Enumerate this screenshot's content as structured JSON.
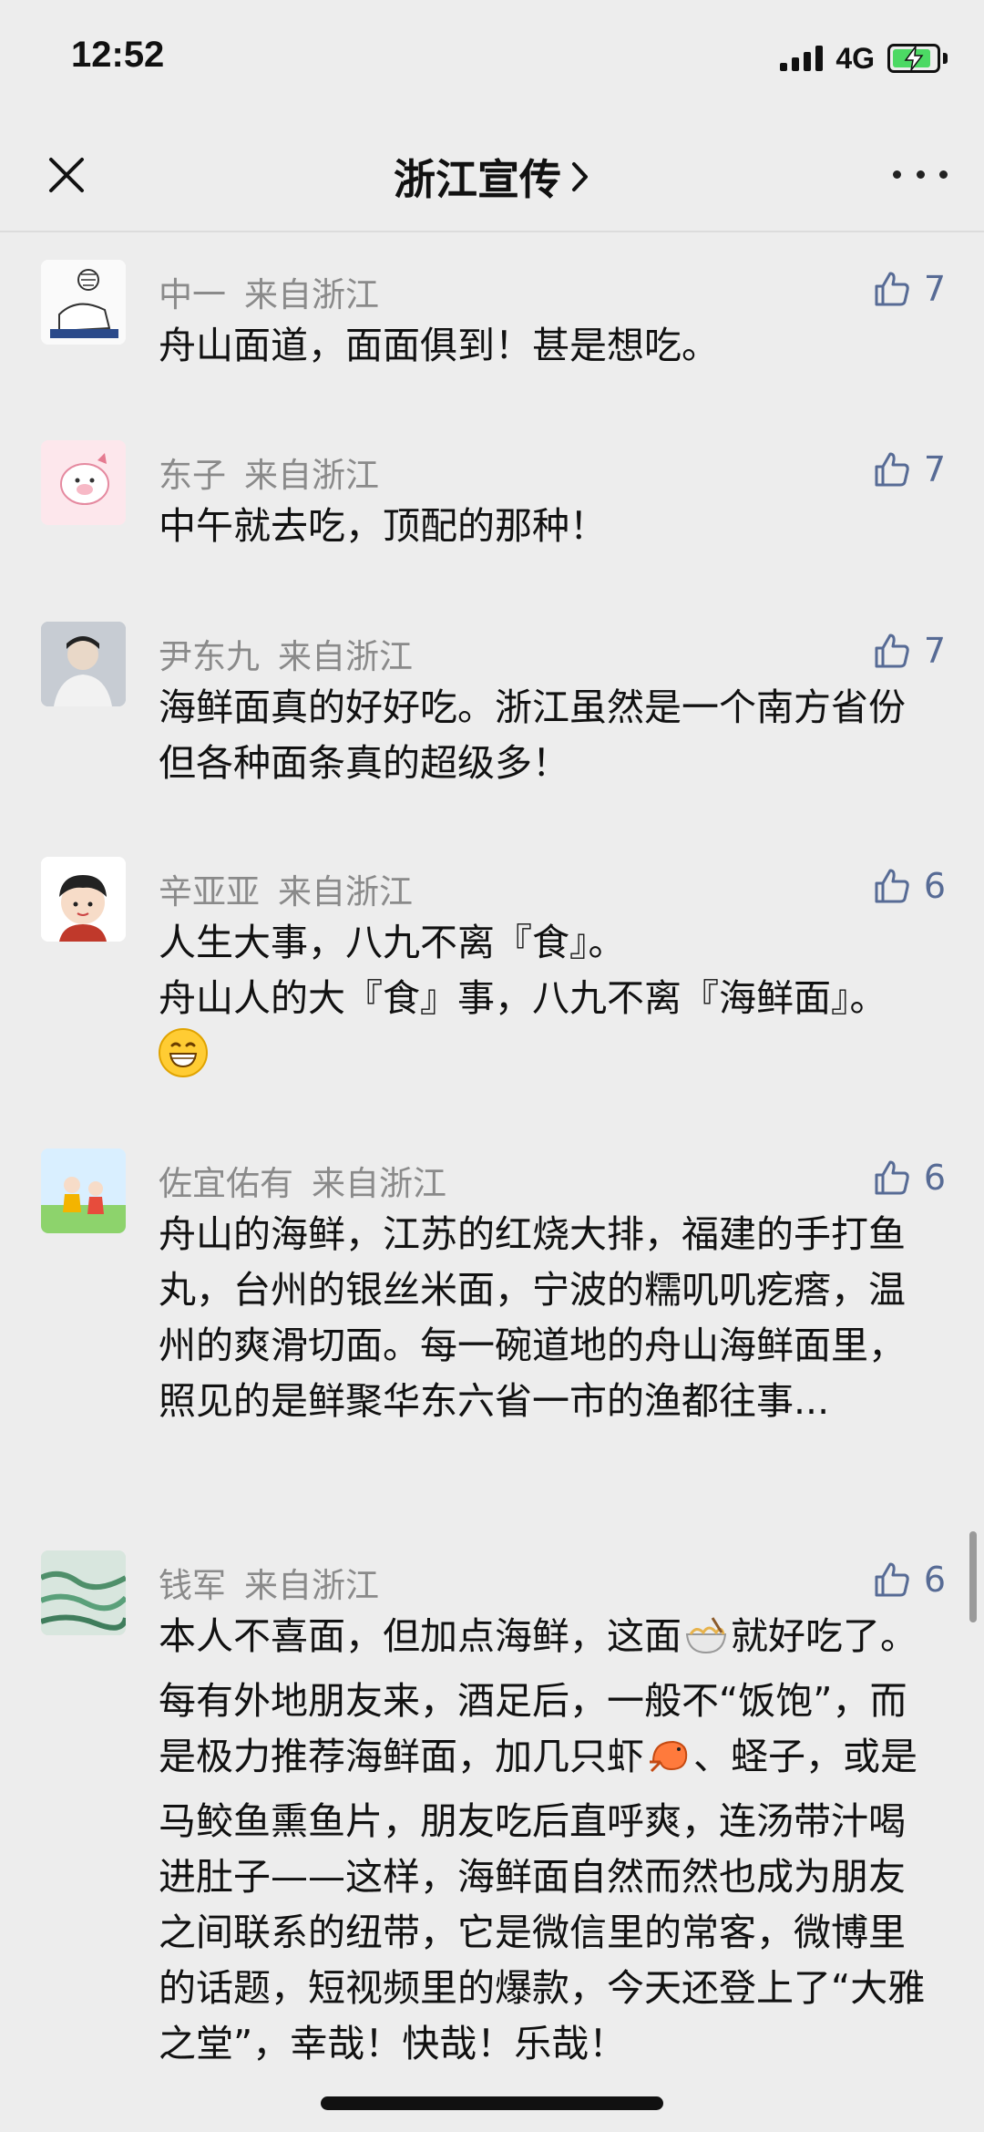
{
  "status_bar": {
    "time": "12:52",
    "network": "4G",
    "battery_icon": "battery-charging-icon",
    "signal_icon": "cellular-signal-icon"
  },
  "nav": {
    "title": "浙江宣传",
    "chevron": "›",
    "close_icon": "close-icon",
    "more_icon": "more-dots-icon"
  },
  "colors": {
    "background": "#ededed",
    "like_blue": "#576b95",
    "meta_gray": "#8a8a8a",
    "text": "#111111"
  },
  "comments": [
    {
      "name": "中一",
      "location": "来自浙江",
      "likes": "7",
      "text": "舟山面道，面面俱到！甚是想吃。"
    },
    {
      "name": "东子",
      "location": "来自浙江",
      "likes": "7",
      "text": "中午就去吃，顶配的那种！"
    },
    {
      "name": "尹东九",
      "location": "来自浙江",
      "likes": "7",
      "text": "海鲜面真的好好吃。浙江虽然是一个南方省份但各种面条真的超级多！"
    },
    {
      "name": "辛亚亚",
      "location": "来自浙江",
      "likes": "6",
      "text_line1": "人生大事，八九不离『食』。",
      "text_line2": "舟山人的大『食』事，八九不离『海鲜面』。",
      "emoji": "grinning-face-emoji"
    },
    {
      "name": "佐宜佑有",
      "location": "来自浙江",
      "likes": "6",
      "text": "舟山的海鲜，江苏的红烧大排，福建的手打鱼丸，台州的银丝米面，宁波的糯叽叽疙瘩，温州的爽滑切面。每一碗道地的舟山海鲜面里，照见的是鲜聚华东六省一市的渔都往事..."
    },
    {
      "name": "钱军",
      "location": "来自浙江",
      "likes": "6",
      "text_a": "本人不喜面，但加点海鲜，这面",
      "text_b": "就好吃了。每有外地朋友来，酒足后，一般不“饭饱”，而是极力推荐海鲜面，加几只虾",
      "text_c": "、蛏子，或是马鲛鱼熏鱼片，朋友吃后直呼爽，连汤带汁喝进肚子——这样，海鲜面自然而然也成为朋友之间联系的纽带，它是微信里的常客，微博里的话题，短视频里的爆款，今天还登上了“大雅之堂”，幸哉！快哉！乐哉！",
      "emoji_noodle": "noodle-bowl-emoji",
      "emoji_shrimp": "shrimp-emoji"
    }
  ]
}
